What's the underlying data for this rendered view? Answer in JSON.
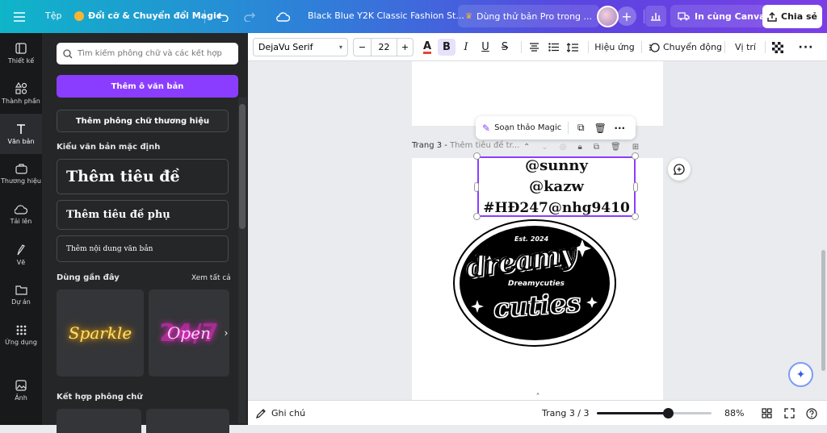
{
  "topbar": {
    "menu_icon": "menu-icon",
    "file_label": "Tệp",
    "magic_switch_label": "Đổi cỡ & Chuyển đổi Magic",
    "doc_title": "Black Blue Y2K Classic Fashion St...",
    "pro_trial_label": "Dùng thử bản Pro trong ...",
    "print_label": "In cùng Canva",
    "share_label": "Chia sẻ"
  },
  "rail": {
    "items": [
      {
        "label": "Thiết kế",
        "icon": "layout-icon"
      },
      {
        "label": "Thành phần",
        "icon": "shapes-icon"
      },
      {
        "label": "Văn bản",
        "icon": "text-icon"
      },
      {
        "label": "Thương hiệu",
        "icon": "brand-icon"
      },
      {
        "label": "Tải lên",
        "icon": "cloud-upload-icon"
      },
      {
        "label": "Vẽ",
        "icon": "draw-icon"
      },
      {
        "label": "Dự án",
        "icon": "folder-icon"
      },
      {
        "label": "Ứng dụng",
        "icon": "apps-icon"
      },
      {
        "label": "Ảnh",
        "icon": "image-icon"
      }
    ]
  },
  "panel": {
    "search_placeholder": "Tìm kiếm phông chữ và các kết hợp",
    "add_textbox": "Thêm ô văn bản",
    "add_brand_font": "Thêm phông chữ thương hiệu",
    "default_styles_heading": "Kiểu văn bản mặc định",
    "add_heading": "Thêm tiêu đề",
    "add_subheading": "Thêm tiêu đề phụ",
    "add_body": "Thêm nội dung văn bản",
    "recent_heading": "Dùng gần đây",
    "see_all": "Xem tất cả",
    "thumb1_text": "Sparkle",
    "thumb2_text": "Open",
    "thumb2_bg": "24/7",
    "combos_heading": "Kết hợp phông chữ"
  },
  "toolbar": {
    "font_name": "DejaVu Serif",
    "font_size": "22",
    "effects": "Hiệu ứng",
    "animate": "Chuyển động",
    "position": "Vị trí"
  },
  "canvas": {
    "magic_write": "Soạn thảo Magic",
    "page_label": "Trang 3 - ",
    "page_title_placeholder": "Thêm tiêu đề tr...",
    "text_lines": [
      "@sunny",
      "@kazw",
      "#HĐ247@nhg9410"
    ],
    "logo": {
      "est": "Est. 2024",
      "word1": "dreamy",
      "middle": "Dreamycuties",
      "word2": "cuties"
    }
  },
  "bottombar": {
    "notes": "Ghi chú",
    "page_counter": "Trang 3 / 3",
    "zoom": "88%",
    "zoom_fraction": 0.62
  },
  "colors": {
    "accent": "#8b3dff",
    "rail_bg": "#18191b",
    "panel_bg": "#252627"
  }
}
